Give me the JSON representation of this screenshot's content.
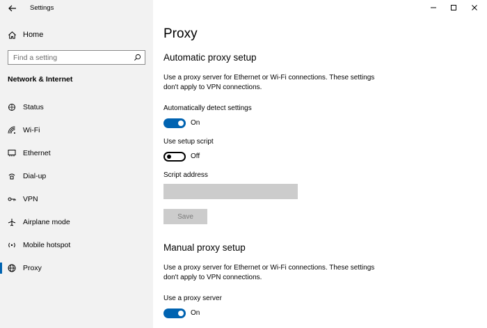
{
  "window": {
    "title": "Settings",
    "controls": [
      "minimize",
      "maximize",
      "close"
    ]
  },
  "sidebar": {
    "home_label": "Home",
    "search_placeholder": "Find a setting",
    "section_title": "Network & Internet",
    "items": [
      {
        "label": "Status",
        "icon": "status-icon"
      },
      {
        "label": "Wi-Fi",
        "icon": "wifi-icon"
      },
      {
        "label": "Ethernet",
        "icon": "ethernet-icon"
      },
      {
        "label": "Dial-up",
        "icon": "dialup-icon"
      },
      {
        "label": "VPN",
        "icon": "vpn-icon"
      },
      {
        "label": "Airplane mode",
        "icon": "airplane-icon"
      },
      {
        "label": "Mobile hotspot",
        "icon": "hotspot-icon"
      },
      {
        "label": "Proxy",
        "icon": "globe-icon",
        "active": true
      }
    ]
  },
  "main": {
    "page_title": "Proxy",
    "automatic": {
      "heading": "Automatic proxy setup",
      "description": "Use a proxy server for Ethernet or Wi-Fi connections. These settings don't apply to VPN connections.",
      "detect_label": "Automatically detect settings",
      "detect_state": "On",
      "script_label": "Use setup script",
      "script_state": "Off",
      "address_label": "Script address",
      "address_value": "",
      "save_label": "Save"
    },
    "manual": {
      "heading": "Manual proxy setup",
      "description": "Use a proxy server for Ethernet or Wi-Fi connections. These settings don't apply to VPN connections.",
      "proxy_label": "Use a proxy server",
      "proxy_state": "On"
    }
  },
  "colors": {
    "accent": "#0063b1",
    "sidebar_bg": "#f2f2f2",
    "disabled_bg": "#cccccc"
  }
}
